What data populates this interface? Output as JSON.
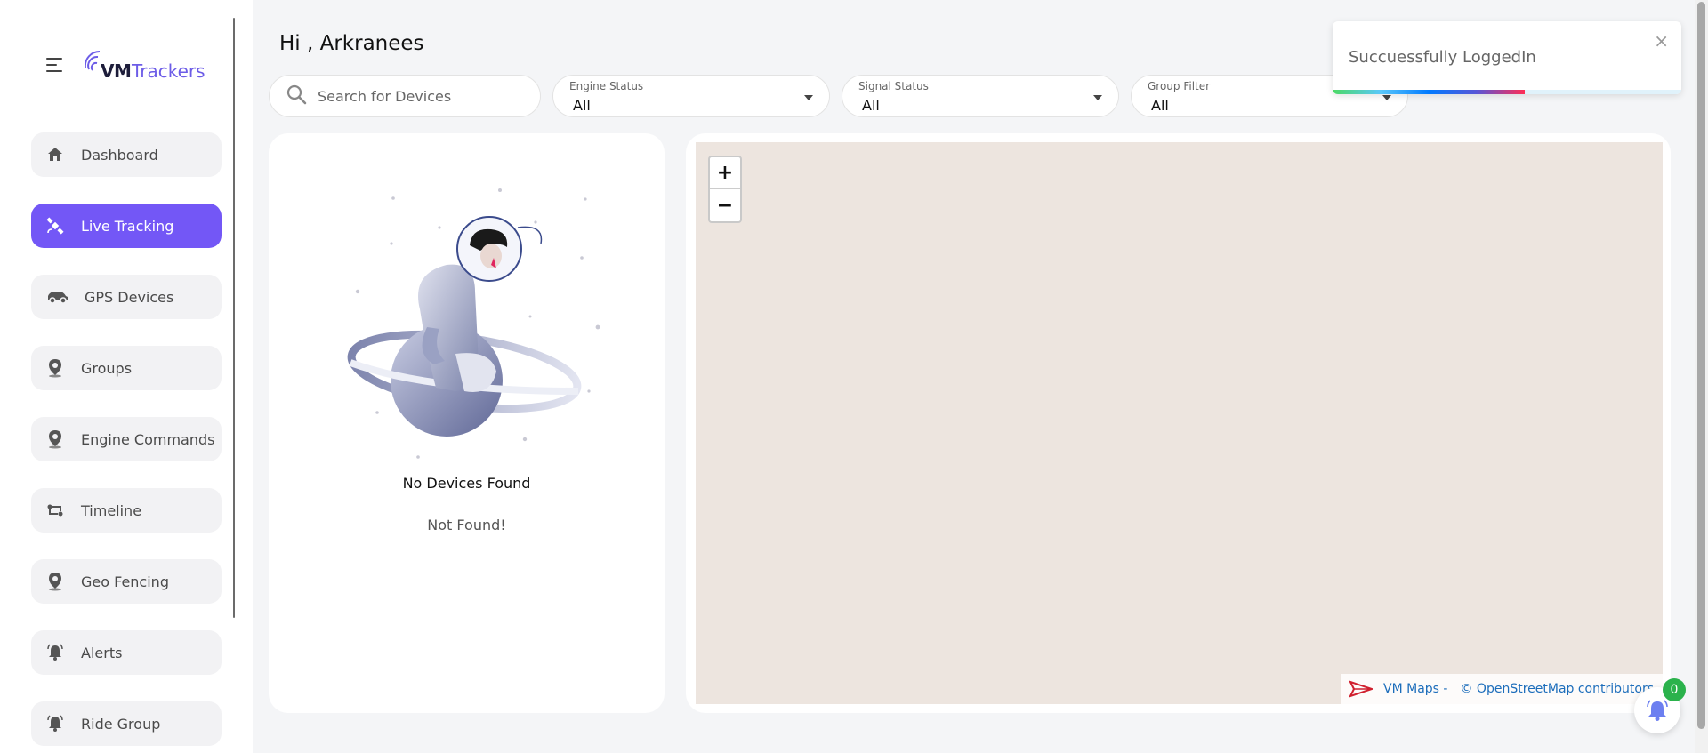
{
  "brand": {
    "logo_vm": "VM",
    "logo_trackers": "Trackers",
    "accent": "#7357f6"
  },
  "sidebar": {
    "items": [
      {
        "label": "Dashboard",
        "icon": "home-icon",
        "active": false
      },
      {
        "label": "Live Tracking",
        "icon": "satellite-icon",
        "active": true
      },
      {
        "label": "GPS Devices",
        "icon": "car-icon",
        "active": false
      },
      {
        "label": "Groups",
        "icon": "location-pin-icon",
        "active": false
      },
      {
        "label": "Engine Commands",
        "icon": "location-pin-icon",
        "active": false
      },
      {
        "label": "Timeline",
        "icon": "route-icon",
        "active": false
      },
      {
        "label": "Geo Fencing",
        "icon": "location-pin-icon",
        "active": false
      },
      {
        "label": "Alerts",
        "icon": "bell-icon",
        "active": false
      },
      {
        "label": "Ride Group",
        "icon": "bell-icon",
        "active": false
      }
    ]
  },
  "header": {
    "greeting": "Hi ,  Arkranees",
    "search_placeholder": "Search for Devices",
    "filters": [
      {
        "caption": "Engine Status",
        "value": "All"
      },
      {
        "caption": "Signal Status",
        "value": "All"
      },
      {
        "caption": "Group Filter",
        "value": "All"
      }
    ]
  },
  "devices_panel": {
    "title": "No Devices Found",
    "subtitle": "Not Found!"
  },
  "map": {
    "zoom_in": "+",
    "zoom_out": "−",
    "attribution_provider": "VM Maps -",
    "attribution_osm": "© OpenStreetMap contributors"
  },
  "toast": {
    "message": "Succuessfully LoggedIn",
    "close": "×",
    "progress": 0.55
  },
  "notifications": {
    "count": "0"
  }
}
